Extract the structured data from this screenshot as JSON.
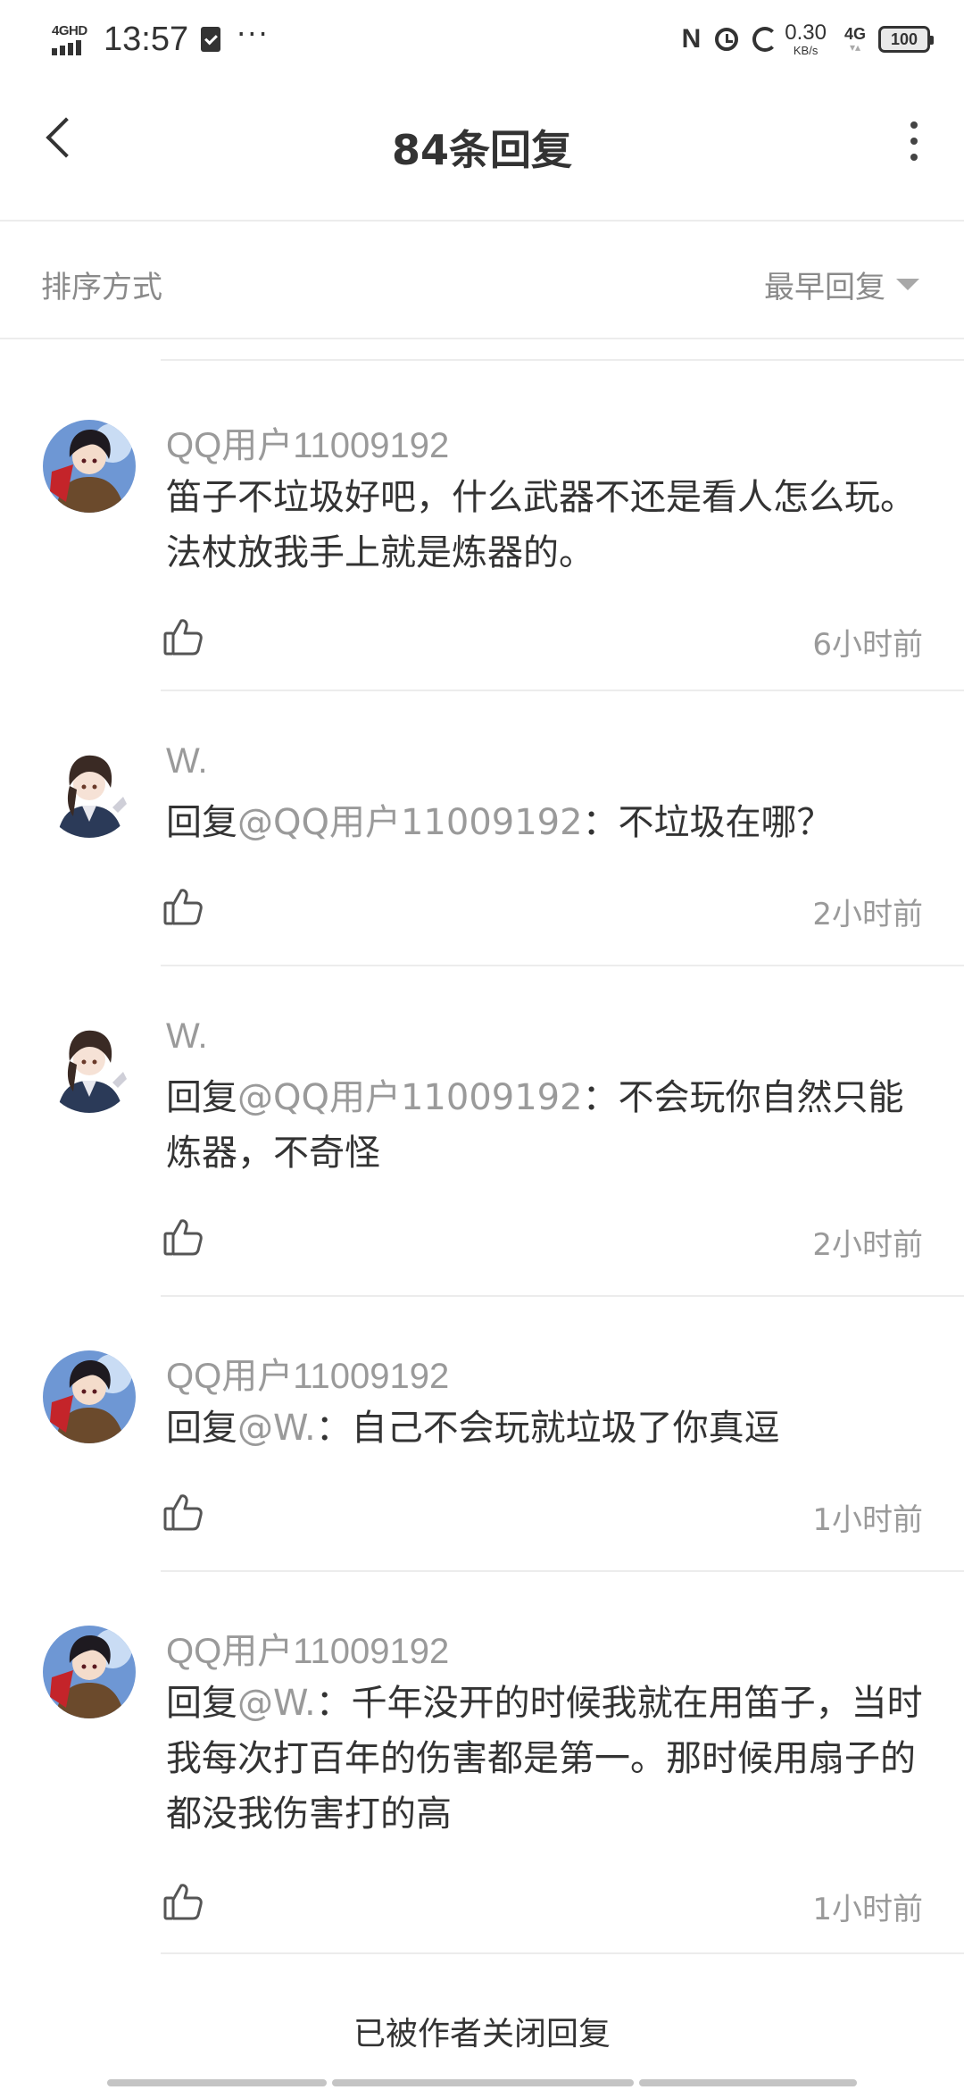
{
  "status_bar": {
    "network_type": "4GHD",
    "time": "13:57",
    "more_indicator": "···",
    "speed_value": "0.30",
    "speed_unit": "KB/s",
    "cellular": "4G",
    "battery": "100"
  },
  "header": {
    "title": "84条回复"
  },
  "sort": {
    "label": "排序方式",
    "value": "最早回复"
  },
  "replies": [
    {
      "username": "QQ用户11009192",
      "prefix": "",
      "mention": "",
      "text": "笛子不垃圾好吧，什么武器不还是看人怎么玩。法杖放我手上就是炼器的。",
      "time": "6小时前"
    },
    {
      "username": "W.",
      "prefix": "回复",
      "mention": "@QQ用户11009192",
      "text": "：不垃圾在哪？",
      "time": "2小时前"
    },
    {
      "username": "W.",
      "prefix": "回复",
      "mention": "@QQ用户11009192",
      "text": "：不会玩你自然只能炼器，不奇怪",
      "time": "2小时前"
    },
    {
      "username": "QQ用户11009192",
      "prefix": "回复",
      "mention": "@W.",
      "text": "：自己不会玩就垃圾了你真逗",
      "time": "1小时前"
    },
    {
      "username": "QQ用户11009192",
      "prefix": "回复",
      "mention": "@W.",
      "text": "：千年没开的时候我就在用笛子，当时我每次打百年的伤害都是第一。那时候用扇子的都没我伤害打的高",
      "time": "1小时前"
    }
  ],
  "footer": {
    "closed_notice": "已被作者关闭回复"
  },
  "colors": {
    "text_primary": "#333333",
    "text_secondary": "#9a9a9a",
    "divider": "#ececec"
  },
  "icons": {
    "back": "chevron-left-icon",
    "overflow": "more-vertical-icon",
    "sort_caret": "caret-down-icon",
    "like": "thumbs-up-icon"
  }
}
